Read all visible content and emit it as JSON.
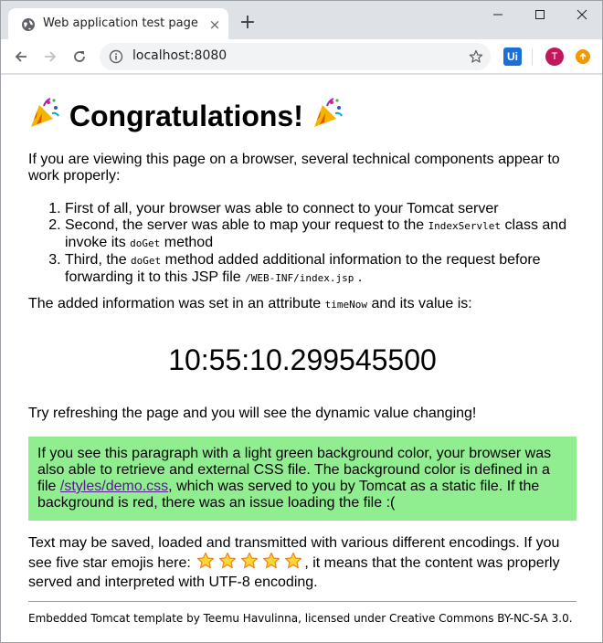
{
  "browser": {
    "tab": {
      "title": "Web application test page",
      "close_glyph": "×"
    },
    "new_tab_glyph": "+",
    "window_controls": [
      "minimize",
      "maximize",
      "close"
    ],
    "toolbar": {
      "url": "localhost:8080",
      "extension_label": "Ui",
      "profile_initial": "T",
      "icons": [
        "back-arrow-icon",
        "forward-arrow-icon",
        "reload-icon",
        "info-icon",
        "bookmark-star-icon",
        "update-icon"
      ]
    }
  },
  "page": {
    "heading": "Congratulations!",
    "intro": "If you are viewing this page on a browser, several technical components appear to work properly:",
    "list": [
      {
        "text": "First of all, your browser was able to connect to your Tomcat server"
      },
      {
        "text_a": "Second, the server was able to map your request to the",
        "code_a": "IndexServlet",
        "text_b": "class and invoke its",
        "code_b": "doGet",
        "text_c": "method"
      },
      {
        "text_a": "Third, the",
        "code_a": "doGet",
        "text_b": "method added additional information to the request before forwarding it to this JSP file",
        "code_b": "/WEB-INF/index.jsp",
        "text_c": "."
      }
    ],
    "attr_sentence": {
      "text_a": "The added information was set in an attribute",
      "code": "timeNow",
      "text_b": "and its value is:"
    },
    "time_now": "10:55:10.299545500",
    "refresh_hint": "Try refreshing the page and you will see the dynamic value changing!",
    "css_box": {
      "text_a": "If you see this paragraph with a light green background color, your browser was also able to retrieve and external CSS file. The background color is defined in a file",
      "link": "/styles/demo.css",
      "text_b": ", which was served to you by Tomcat as a static file. If the background is red, there was an issue loading the file :(",
      "background_color": "#90ee90"
    },
    "encoding": {
      "text_a": "Text may be saved, loaded and transmitted with various different encodings. If you see five star emojis here:",
      "star_count": 5,
      "text_b": ", it means that the content was properly served and interpreted with UTF-8 encoding."
    },
    "footer": "Embedded Tomcat template by Teemu Havulinna, licensed under Creative Commons BY-NC-SA 3.0."
  }
}
